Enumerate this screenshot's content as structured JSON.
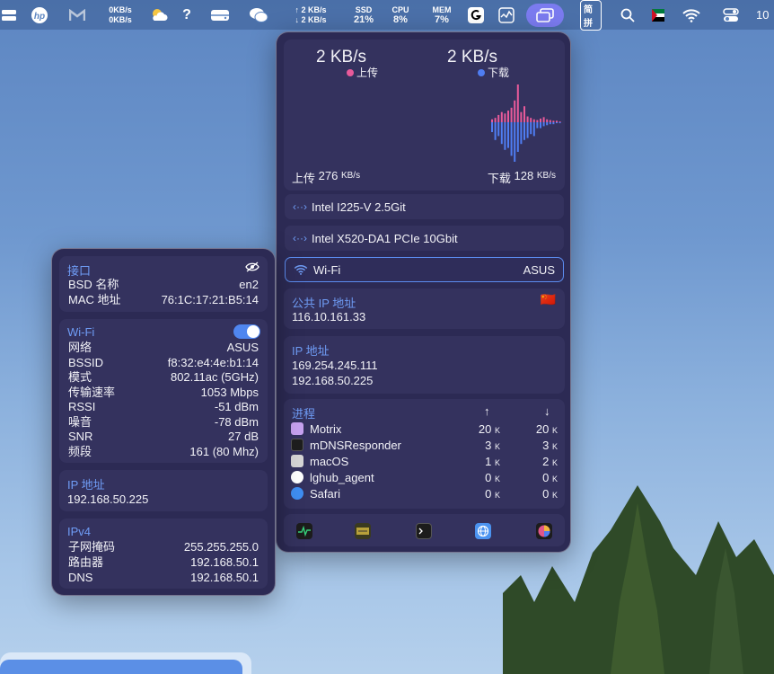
{
  "menubar": {
    "net_up": "0KB/s",
    "net_down": "0KB/s",
    "help": "?",
    "net_up2": "↑  2 KB/s",
    "net_down2": "↓  2 KB/s",
    "ssd_label": "SSD",
    "ssd_value": "21%",
    "cpu_label": "CPU",
    "cpu_value": "8%",
    "mem_label": "MEM",
    "mem_value": "7%",
    "ime": "简拼",
    "clock": "10"
  },
  "network_panel": {
    "upload_speed": "2 KB/s",
    "download_speed": "2 KB/s",
    "upload_legend": "上传",
    "download_legend": "下载",
    "upload_total_label": "上传",
    "upload_total_value": "276",
    "upload_total_unit": "KB/s",
    "download_total_label": "下载",
    "download_total_value": "128",
    "download_total_unit": "KB/s",
    "chart_colors": {
      "upload": "#e85a9a",
      "download": "#4f7df2"
    },
    "chart_data": {
      "type": "bar",
      "series": [
        {
          "name": "上传",
          "values": [
            4,
            6,
            10,
            14,
            12,
            16,
            20,
            30,
            52,
            14,
            22,
            8,
            6,
            4,
            3,
            5,
            7,
            4,
            3,
            2,
            2,
            1
          ]
        },
        {
          "name": "下载",
          "values": [
            10,
            18,
            14,
            22,
            28,
            26,
            34,
            40,
            30,
            22,
            18,
            16,
            12,
            14,
            6,
            6,
            4,
            3,
            2,
            2,
            1,
            1
          ]
        }
      ]
    },
    "interfaces": [
      {
        "name": "Intel I225-V 2.5Git",
        "value": ""
      },
      {
        "name": "Intel X520-DA1 PCIe 10Gbit",
        "value": ""
      },
      {
        "name": "Wi-Fi",
        "value": "ASUS"
      }
    ],
    "public_ip": {
      "title": "公共 IP 地址",
      "value": "116.10.161.33",
      "flag": "🇨🇳"
    },
    "ip": {
      "title": "IP 地址",
      "values": [
        "169.254.245.111",
        "192.168.50.225"
      ]
    },
    "processes": {
      "title": "进程",
      "up_header": "↑",
      "down_header": "↓",
      "unit": "K",
      "rows": [
        {
          "name": "Motrix",
          "up": "20",
          "down": "20",
          "icon_color": "#c7a2f0"
        },
        {
          "name": "mDNSResponder",
          "up": "3",
          "down": "3",
          "icon_color": "#1e1e1e"
        },
        {
          "name": "macOS",
          "up": "1",
          "down": "2",
          "icon_color": "#d6d6d6"
        },
        {
          "name": "lghub_agent",
          "up": "0",
          "down": "0",
          "icon_color": "#ffffff"
        },
        {
          "name": "Safari",
          "up": "0",
          "down": "0",
          "icon_color": "#3f8ef2"
        }
      ]
    }
  },
  "details_panel": {
    "interface": {
      "title": "接口",
      "rows": [
        {
          "label": "BSD 名称",
          "value": "en2"
        },
        {
          "label": "MAC 地址",
          "value": "76:1C:17:21:B5:14"
        }
      ]
    },
    "wifi": {
      "title": "Wi-Fi",
      "rows": [
        {
          "label": "网络",
          "value": "ASUS"
        },
        {
          "label": "BSSID",
          "value": "f8:32:e4:4e:b1:14"
        },
        {
          "label": "模式",
          "value": "802.11ac (5GHz)"
        },
        {
          "label": "传输速率",
          "value": "1053 Mbps"
        },
        {
          "label": "RSSI",
          "value": "-51 dBm"
        },
        {
          "label": "噪音",
          "value": "-78 dBm"
        },
        {
          "label": "SNR",
          "value": "27 dB"
        },
        {
          "label": "频段",
          "value": "161 (80 Mhz)"
        }
      ]
    },
    "ip": {
      "title": "IP 地址",
      "value": "192.168.50.225"
    },
    "ipv4": {
      "title": "IPv4",
      "rows": [
        {
          "label": "子网掩码",
          "value": "255.255.255.0"
        },
        {
          "label": "路由器",
          "value": "192.168.50.1"
        },
        {
          "label": "DNS",
          "value": "192.168.50.1"
        }
      ]
    }
  }
}
